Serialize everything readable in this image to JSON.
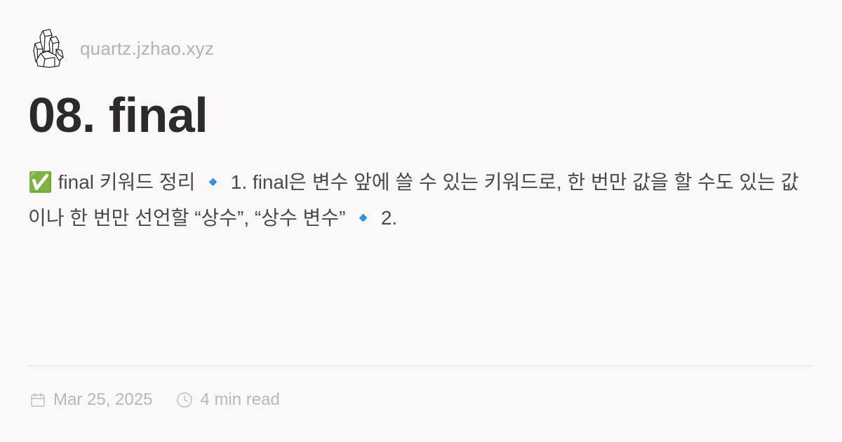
{
  "header": {
    "logo_icon": "crystal-cluster-icon",
    "site_name": "quartz.jzhao.xyz"
  },
  "title": "08. final",
  "description": "✅ final 키워드 정리 🔹 1. final은 변수 앞에 쓸 수 있는 키워드로, 한 번만 값을 할 수도 있는 값이나 한 번만 선언할 “상수”, “상수 변수” 🔹 2.",
  "meta": {
    "date_icon": "calendar-icon",
    "date": "Mar 25, 2025",
    "reading_time_icon": "clock-icon",
    "reading_time": "4 min read"
  },
  "colors": {
    "background": "#faf8f8",
    "title": "#2b2b2b",
    "muted": "#b3b3b3",
    "divider": "#e6e4e4"
  }
}
